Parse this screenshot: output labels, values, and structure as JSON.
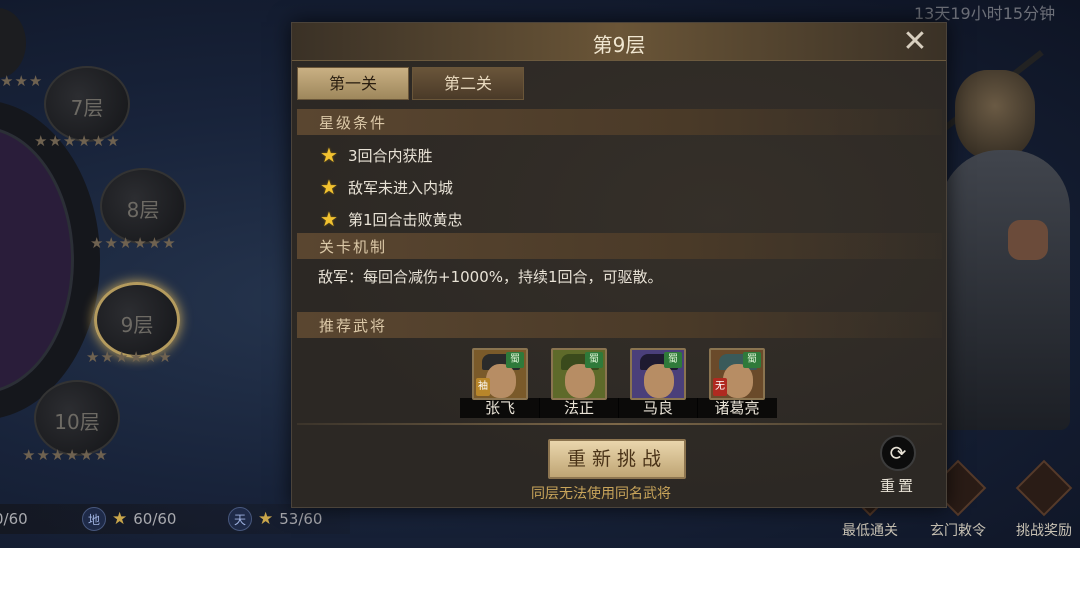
{
  "hud": {
    "timer": "13天19小时15分钟"
  },
  "tower": {
    "floors": [
      {
        "label": "7层",
        "stars": "★★★★★★"
      },
      {
        "label": "8层",
        "stars": "★★★★★★"
      },
      {
        "label": "9层",
        "stars": "★★★★★★"
      },
      {
        "label": "10层",
        "stars": "★★★★★★"
      }
    ],
    "top_stars": "★★★"
  },
  "counters": [
    {
      "badge": "",
      "value": "0/60"
    },
    {
      "badge": "地",
      "value": "60/60"
    },
    {
      "badge": "天",
      "value": "53/60"
    }
  ],
  "bottom_buttons": [
    {
      "label": "最低通关",
      "icon": "scroll-icon"
    },
    {
      "label": "玄门敕令",
      "icon": "decree-icon"
    },
    {
      "label": "挑战奖励",
      "icon": "chest-icon"
    }
  ],
  "dialog": {
    "title": "第9层",
    "tabs": [
      {
        "label": "第一关",
        "selected": true
      },
      {
        "label": "第二关",
        "selected": false
      }
    ],
    "star_section": "星级条件",
    "conditions": [
      "3回合内获胜",
      "敌军未进入内城",
      "第1回合击败黄忠"
    ],
    "mechanic_section": "关卡机制",
    "mechanic_text": "敌军：每回合减伤+1000%，持续1回合，可驱散。",
    "recommend_section": "推荐武将",
    "heroes": [
      {
        "name": "张飞",
        "faction": "蜀",
        "tag": "袖",
        "color": "#7a5a2a"
      },
      {
        "name": "法正",
        "faction": "蜀",
        "tag": "",
        "color": "#5e6a2a"
      },
      {
        "name": "马良",
        "faction": "蜀",
        "tag": "",
        "color": "#4a3f7a"
      },
      {
        "name": "诸葛亮",
        "faction": "蜀",
        "tag": "无",
        "color": "#6a4a2a"
      }
    ],
    "retry_label": "重新挑战",
    "hint": "同层无法使用同名武将",
    "reset_label": "重置"
  },
  "colors": {
    "gold_star": "#f2c230",
    "accent": "#c8a45a",
    "panel": "#2c2824"
  }
}
